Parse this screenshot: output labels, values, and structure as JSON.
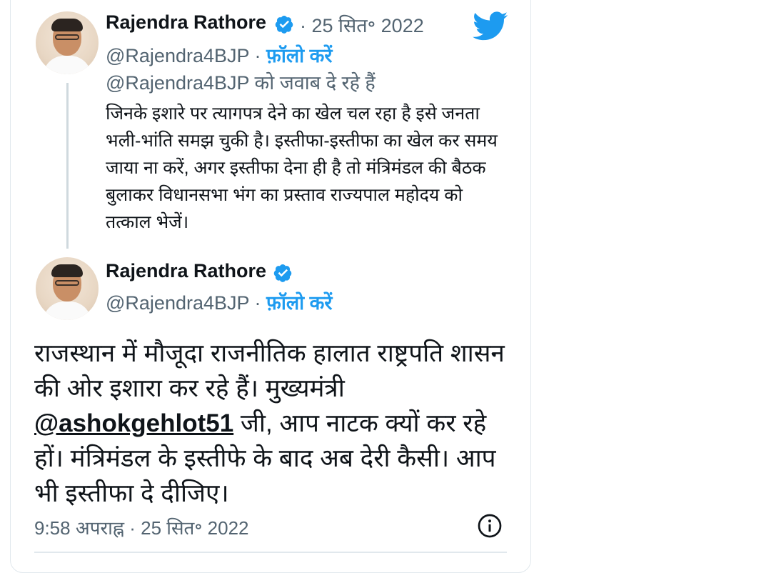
{
  "reply_tweet": {
    "author_name": "Rajendra Rathore",
    "date": "· 25 सित॰ 2022",
    "handle": "@Rajendra4BJP",
    "follow_label": "फ़ॉलो करें",
    "replying_to": "@Rajendra4BJP को जवाब दे रहे हैं",
    "text": "जिनके इशारे पर त्यागपत्र देने का खेल चल रहा है इसे जनता भली-भांति समझ चुकी है। इस्तीफा-इस्तीफा का खेल कर समय जाया ना करें, अगर इस्तीफा देना ही है तो मंत्रिमंडल की बैठक बुलाकर विधानसभा भंग का प्रस्ताव राज्यपाल महोदय को तत्काल भेजें।"
  },
  "main_tweet": {
    "author_name": "Rajendra Rathore",
    "handle": "@Rajendra4BJP",
    "follow_label": "फ़ॉलो करें",
    "text_before": "राजस्थान में मौजूदा राजनीतिक हालात राष्ट्रपति शासन की ओर इशारा कर रहे हैं। मुख्यमंत्री ",
    "mention": "@ashokgehlot51",
    "text_after": " जी, आप नाटक क्यों कर रहे हों। मंत्रिमंडल के इस्तीफे के बाद अब देरी कैसी। आप भी इस्तीफा दे दीजिए।",
    "timestamp": "9:58 अपराह्न · 25 सित॰ 2022"
  },
  "icons": {
    "brand": "twitter-bird-icon",
    "verified": "verified-badge-icon",
    "info": "info-icon"
  },
  "colors": {
    "twitter_blue": "#1d9bf0",
    "text": "#0f1419",
    "muted": "#536471"
  }
}
